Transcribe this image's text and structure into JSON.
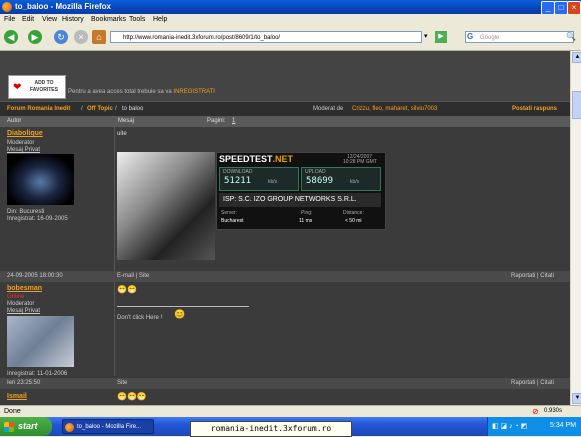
{
  "window": {
    "title": "to_baloo - Mozilla Firefox"
  },
  "menu": [
    "File",
    "Edit",
    "View",
    "History",
    "Bookmarks",
    "Tools",
    "Help"
  ],
  "toolbar": {
    "url": "http://www.romania-inedit.3xforum.ro/post/8609/1/to_baloo/",
    "search_placeholder": "Google"
  },
  "forum": {
    "fav_button": "ADD TO FAVORITES",
    "notice_text": "Pentru a avea acces total trebuie sa va",
    "notice_link": "INREGISTRATI",
    "breadcrumb": {
      "forum": "Forum Romania Inedit",
      "sep1": " / ",
      "section": "Off Topic",
      "sep2": " / ",
      "topic": "to baloo"
    },
    "moderators_label": "Moderat de",
    "moderators": "Crizzu, fleo, maharet, silviu7003",
    "post_reply": "Postati raspuns",
    "col_author": "Autor",
    "col_message": "Mesaj",
    "pages_label": "Pagini:",
    "pages_value": "1"
  },
  "posts": [
    {
      "author": "Diabolique",
      "role": "Moderator",
      "pm": "Mesaj Privat",
      "location": "Din: Bucuresti",
      "registered": "Inregistrat: 16-09-2005",
      "message": "uite",
      "date": "24-09-2005 18:00:30",
      "links": "E-mail | Site",
      "actions": "Raportati | Citati"
    },
    {
      "author": "bobesman",
      "status": "Online",
      "role": "Moderator",
      "pm": "Mesaj Privat",
      "registered": "Inregistrat: 11-01-2006",
      "message": "Don't click Here !",
      "date": "Ieri 23:25:50",
      "links": "Site",
      "actions": "Raportati | Citati"
    },
    {
      "author": "Ismail"
    }
  ],
  "speedtest": {
    "logo": "SPEEDTEST",
    "logo_suffix": ".NET",
    "date": "12/24/2007",
    "time": "10:28 PM GMT",
    "download_label": "DOWNLOAD",
    "download_value": "51211",
    "download_unit": "kb/s",
    "upload_label": "UPLOAD",
    "upload_value": "58699",
    "upload_unit": "kb/s",
    "isp": "ISP: S.C. IZO GROUP NETWORKS S.R.L.",
    "server_label": "Server:",
    "server_value": "Bucharest",
    "ping_label": "Ping:",
    "ping_value": "11 ms",
    "distance_label": "Distance:",
    "distance_value": "< 50 mi"
  },
  "status": {
    "text": "Done",
    "timer": "0.930s"
  },
  "taskbar": {
    "start": "start",
    "item": "to_baloo - Mozilla Fire...",
    "clock": "5:34 PM"
  },
  "tooltip": "romania-inedit.3xforum.ro"
}
